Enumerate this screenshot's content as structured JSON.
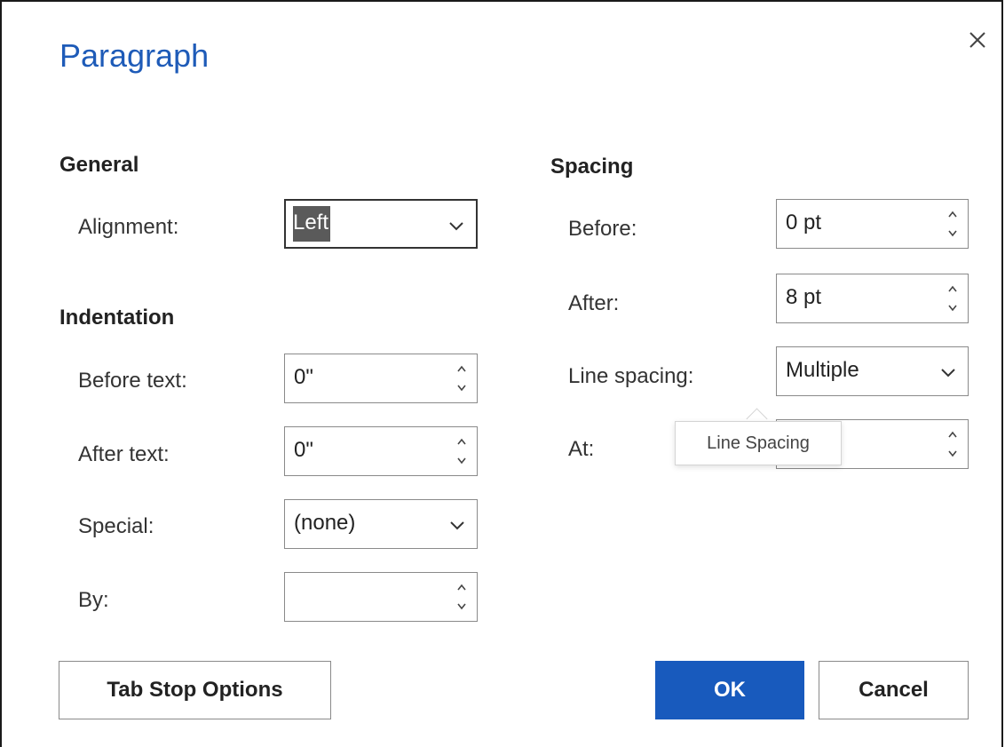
{
  "dialog": {
    "title": "Paragraph",
    "close_icon": "close-icon"
  },
  "general": {
    "heading": "General",
    "alignment_label": "Alignment:",
    "alignment_value": "Left"
  },
  "indentation": {
    "heading": "Indentation",
    "before_text_label": "Before text:",
    "before_text_value": "0\"",
    "after_text_label": "After text:",
    "after_text_value": "0\"",
    "special_label": "Special:",
    "special_value": "(none)",
    "by_label": "By:",
    "by_value": ""
  },
  "spacing": {
    "heading": "Spacing",
    "before_label": "Before:",
    "before_value": "0 pt",
    "after_label": "After:",
    "after_value": "8 pt",
    "line_spacing_label": "Line spacing:",
    "line_spacing_value": "Multiple",
    "at_label": "At:",
    "at_value": ""
  },
  "tooltip": {
    "text": "Line Spacing"
  },
  "buttons": {
    "tab_stop_options": "Tab Stop Options",
    "ok": "OK",
    "cancel": "Cancel"
  },
  "colors": {
    "title": "#1e5bb8",
    "primary_button": "#185abd"
  }
}
